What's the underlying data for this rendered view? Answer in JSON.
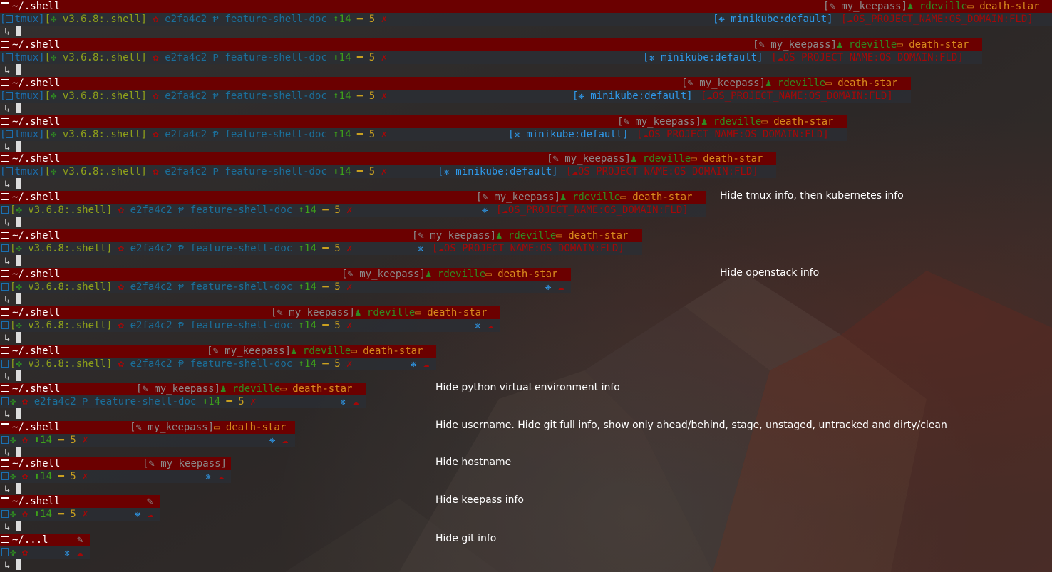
{
  "colors": {
    "prompt_bar": "#6b0000",
    "status_bar": "#2a2e34",
    "background": "#2e2a29",
    "accent_blue": "#2f98e8",
    "accent_green": "#3ea01a",
    "accent_orange": "#d88a1c",
    "accent_red": "#a40808"
  },
  "prompt": {
    "dir": "~/.shell",
    "dir_short": "~/...l",
    "arrow": "↳"
  },
  "segments": {
    "keepass_l": "[",
    "keepass": " my_keepass",
    "keepass_r": "]",
    "user": "rdeville",
    "host": "death-star",
    "tmux": "tmux",
    "python": " v3.6.8:.shell",
    "git_hash": "e2fa4c2",
    "git_branch": "feature-shell-doc",
    "git_ahead": "14",
    "git_staged": "5",
    "git_x": "✗",
    "kube": "minikube:default",
    "openstack": "OS_PROJECT_NAME:OS_DOMAIN:FLD",
    "lbr": "[",
    "rbr": "]"
  },
  "icons": {
    "folder": "folder-open-icon",
    "key": "key-icon",
    "user": "user-icon",
    "host": "monitor-icon",
    "tmux": "columns-icon",
    "python": "python-icon",
    "git": "git-icon",
    "branch": "branch-icon",
    "ahead": "arrow-up-icon",
    "staged": "dash-icon",
    "kube": "helm-icon",
    "openstack": "cloud-icon"
  },
  "notes": {
    "n1": "Hide tmux info, then kubernetes info",
    "n2": "Hide openstack info",
    "n3": "Hide python virtual environment info",
    "n4": "Hide username. Hide git full info, show only ahead/behind, stage, unstaged, untracked and dirty/clean",
    "n5": "Hide hostname",
    "n6": "Hide keepass info",
    "n7": "Hide git info"
  }
}
